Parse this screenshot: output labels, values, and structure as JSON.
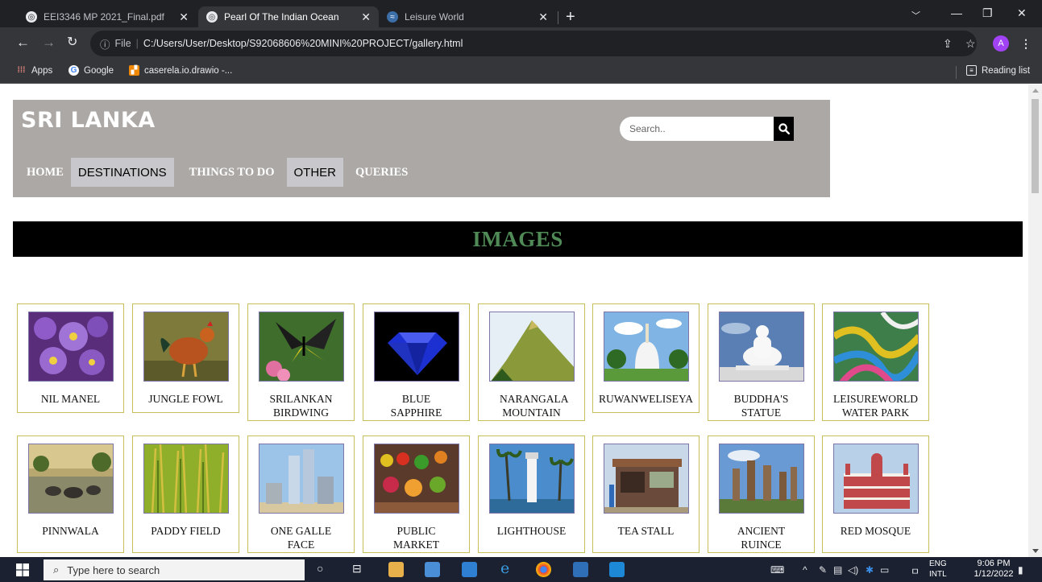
{
  "browser": {
    "tabs": [
      {
        "title": "EEI3346 MP 2021_Final.pdf",
        "active": false
      },
      {
        "title": "Pearl Of The Indian Ocean",
        "active": true
      },
      {
        "title": "Leisure World",
        "active": false
      }
    ],
    "address": {
      "scheme": "File",
      "url": "C:/Users/User/Desktop/S92068606%20MINI%20PROJECT/gallery.html"
    },
    "profile_initial": "A",
    "bookmarks": [
      {
        "label": "Apps",
        "icon": "apps-grid-icon"
      },
      {
        "label": "Google",
        "icon": "google-icon"
      },
      {
        "label": "caserela.io.drawio -...",
        "icon": "drawio-icon"
      }
    ],
    "reading_list": "Reading list"
  },
  "site": {
    "brand": "SRI LANKA",
    "search_placeholder": "Search..",
    "nav": [
      "HOME",
      "DESTINATIONS",
      "THINGS TO DO",
      "OTHER",
      "QUERIES"
    ],
    "banner": "IMAGES"
  },
  "gallery": [
    {
      "caption": "NIL MANEL",
      "scene": "purple-flowers"
    },
    {
      "caption": "JUNGLE FOWL",
      "scene": "rooster"
    },
    {
      "caption": "SRILANKAN BIRDWING",
      "scene": "butterfly"
    },
    {
      "caption": "BLUE SAPPHIRE",
      "scene": "gem"
    },
    {
      "caption": "NARANGALA MOUNTAIN",
      "scene": "mountain"
    },
    {
      "caption": "RUWANWELISEYA",
      "scene": "stupa"
    },
    {
      "caption": "BUDDHA'S STATUE",
      "scene": "buddha"
    },
    {
      "caption": "LEISUREWORLD WATER PARK",
      "scene": "waterpark"
    },
    {
      "caption": "PINNWALA",
      "scene": "elephants"
    },
    {
      "caption": "PADDY FIELD",
      "scene": "paddy"
    },
    {
      "caption": "ONE GALLE FACE",
      "scene": "towers"
    },
    {
      "caption": "PUBLIC MARKET",
      "scene": "market"
    },
    {
      "caption": "LIGHTHOUSE",
      "scene": "lighthouse"
    },
    {
      "caption": "TEA STALL",
      "scene": "teastall"
    },
    {
      "caption": "ANCIENT RUINCE",
      "scene": "ruins"
    },
    {
      "caption": "RED MOSQUE",
      "scene": "mosque"
    }
  ],
  "taskbar": {
    "search_placeholder": "Type here to search",
    "language": "ENG",
    "language_sub": "INTL",
    "time": "9:06 PM",
    "date": "1/12/2022"
  }
}
